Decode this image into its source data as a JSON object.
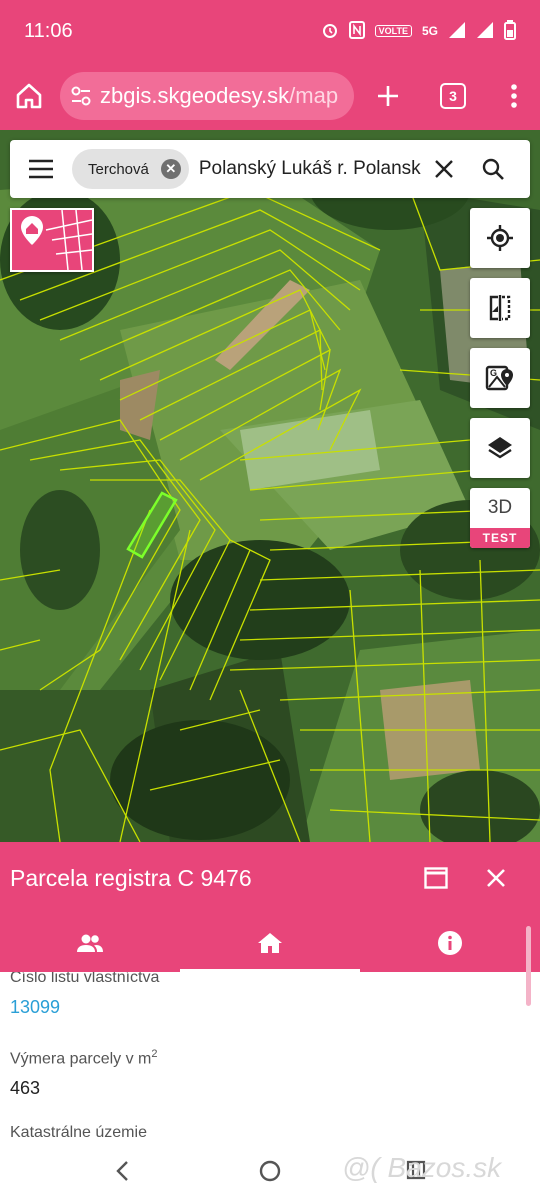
{
  "status": {
    "time": "11:06",
    "icons": [
      "alarm-icon",
      "nfc-icon",
      "volte-icon",
      "5g-icon",
      "signal-icon",
      "signal-icon",
      "battery-icon"
    ],
    "volte": "VOLTE",
    "net": "5G"
  },
  "browser": {
    "url_host": "zbgis.skgeodesy.sk",
    "url_path": "/map",
    "tab_count": "3"
  },
  "search": {
    "chip_label": "Terchová",
    "query": "Polanský Lukáš r. Polansk"
  },
  "map_buttons": {
    "three_d": "3D",
    "test": "TEST"
  },
  "panel": {
    "title": "Parcela registra C 9476",
    "tabs": [
      "owners-icon",
      "home-icon",
      "info-icon"
    ],
    "fields": [
      {
        "label": "Číslo listu vlastníctva",
        "value": "13099"
      },
      {
        "label": "Výmera parcely v m",
        "label_sup": "2",
        "value": "463"
      },
      {
        "label": "Katastrálne územie",
        "value": ""
      }
    ]
  },
  "watermark": "@( Bazos.sk",
  "colors": {
    "brand": "#e8457a",
    "link": "#2a9fd6",
    "parcel_highlight": "#7cff2a"
  }
}
